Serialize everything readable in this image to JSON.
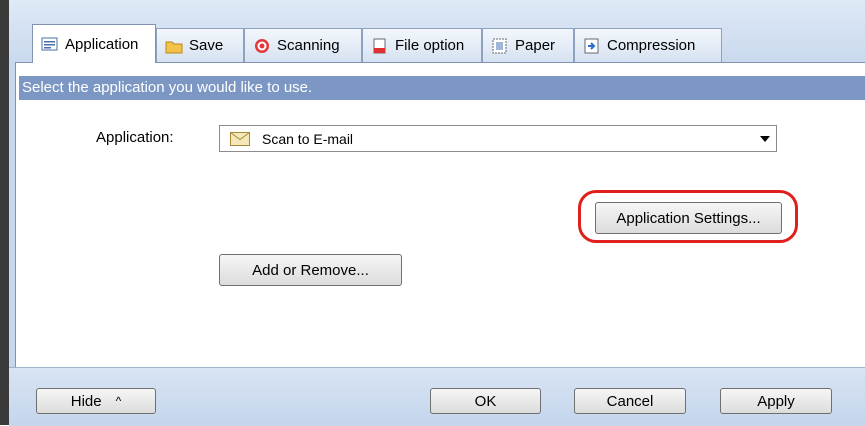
{
  "tabs": [
    {
      "label": "Application",
      "icon": "application-icon",
      "active": true
    },
    {
      "label": "Save",
      "icon": "folder-icon"
    },
    {
      "label": "Scanning",
      "icon": "scanning-icon"
    },
    {
      "label": "File option",
      "icon": "file-option-icon"
    },
    {
      "label": "Paper",
      "icon": "paper-icon"
    },
    {
      "label": "Compression",
      "icon": "compression-icon"
    }
  ],
  "panel": {
    "instruction": "Select the application you would like to use.",
    "application_label": "Application:",
    "application_value": "Scan to E-mail",
    "application_icon": "envelope-icon",
    "settings_button": "Application Settings...",
    "add_remove_button": "Add or Remove...",
    "highlight_color": "#e0201c"
  },
  "footer": {
    "hide_button": "Hide",
    "ok_button": "OK",
    "cancel_button": "Cancel",
    "apply_button": "Apply"
  }
}
